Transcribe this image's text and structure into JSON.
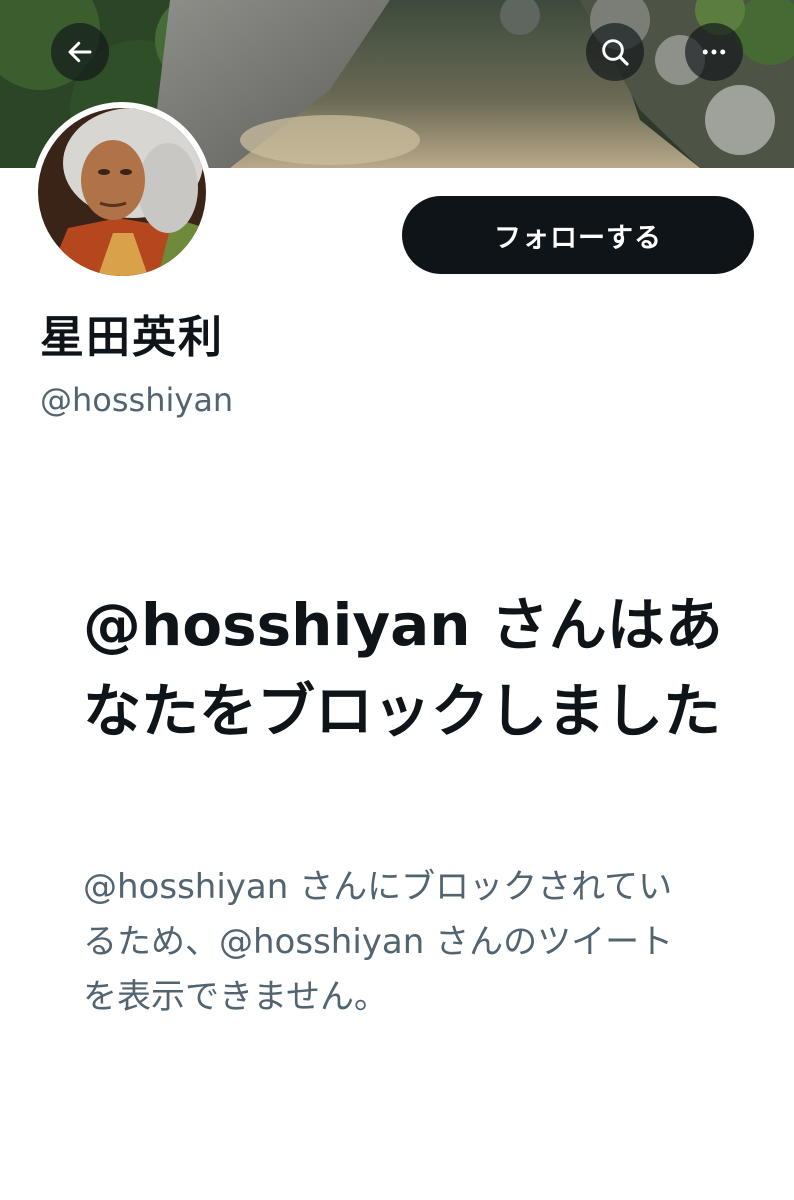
{
  "header": {
    "back_icon": "arrow-left-icon",
    "search_icon": "search-icon",
    "more_icon": "more-horizontal-icon"
  },
  "profile": {
    "display_name": "星田英利",
    "handle": "@hosshiyan",
    "follow_button_label": "フォローする"
  },
  "blocked_notice": {
    "title": "@hosshiyan さんはあなたをブロックしました",
    "description": "@hosshiyan さんにブロックされているため、@hosshiyan さんのツイートを表示できません。"
  },
  "colors": {
    "primary_text": "#0f1419",
    "secondary_text": "#536471",
    "button_bg": "#0f1419",
    "button_text": "#ffffff"
  }
}
